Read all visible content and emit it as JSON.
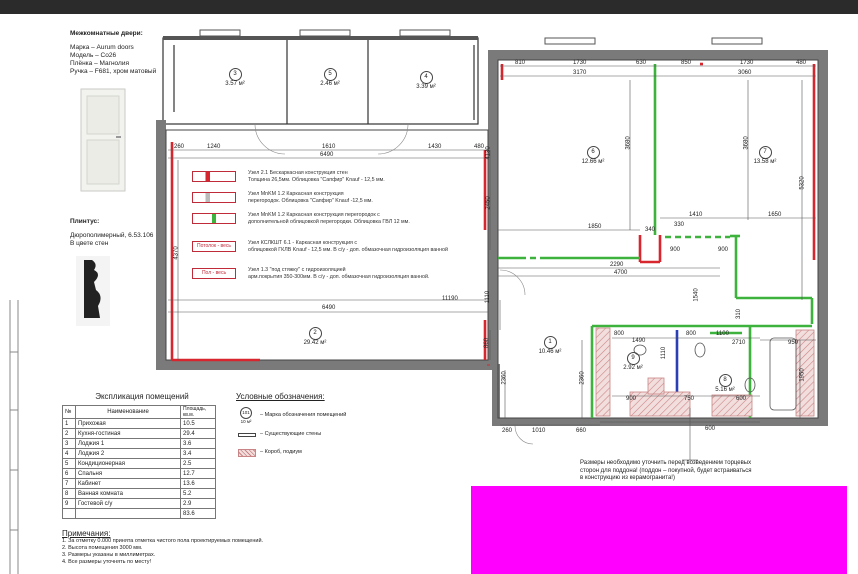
{
  "doors": {
    "title": "Межкомнатные двери:",
    "lines": [
      "Марка – Aurum doors",
      "Модель – Co26",
      "Плёнка – Магнолия",
      "Ручка – F681, хром матовый"
    ]
  },
  "plinth": {
    "title": "Плинтус:",
    "lines": [
      "Дюрополимерный, 6.53.106",
      "В цвете стен"
    ]
  },
  "rooms": [
    {
      "num": "3",
      "area": "3.57 м²"
    },
    {
      "num": "5",
      "area": "2.46 м²"
    },
    {
      "num": "4",
      "area": "3.39 м²"
    },
    {
      "num": "6",
      "area": "12.66 м²"
    },
    {
      "num": "7",
      "area": "13.58 м²"
    },
    {
      "num": "2",
      "area": "29.42 м²"
    },
    {
      "num": "1",
      "area": "10.46 м²"
    },
    {
      "num": "9",
      "area": "2.92 м²"
    },
    {
      "num": "8",
      "area": "5.16 м²"
    }
  ],
  "dims": {
    "top": [
      "810",
      "1730",
      "630",
      "850",
      "1730",
      "480"
    ],
    "top2": [
      "3170",
      "3060"
    ],
    "left_top": [
      "260",
      "1240",
      "1610",
      "1430",
      "400",
      "480"
    ],
    "left_total": "6490",
    "mid": [
      "1850",
      "2290",
      "4700",
      "1410",
      "1650",
      "900",
      "340",
      "330",
      "900"
    ],
    "long": "11190",
    "bottom_row": "6490",
    "vertical": [
      "4130",
      "2450",
      "1880",
      "3680",
      "5320",
      "4370",
      "1110",
      "860",
      "2360",
      "2360"
    ],
    "lower": [
      "800",
      "1490",
      "800",
      "1100",
      "2710",
      "950",
      "900",
      "1110",
      "1540",
      "600",
      "310",
      "660",
      "1010",
      "260",
      "750",
      "600",
      "1950"
    ]
  },
  "legend": [
    {
      "text": "Узел 2.1 Бескаркасная конструкция стен\nТолщина 26,5мм. Облицовка \"Сапфир\" Knauf - 12,5 мм.",
      "swatch": ""
    },
    {
      "text": "Узел MnKM 1.2 Каркасная конструкция\nперегородок. Облицовка \"Сапфир\" Knauf -12,5 мм.",
      "swatch": ""
    },
    {
      "text": "Узел MnKM 1.2 Каркасная конструкция перегородок с\nдополнительной облицовкой перегородки. Облицовка ГВЛ 12 мм.",
      "swatch": ""
    },
    {
      "text": "Узел КСЛКШТ 6.1 - Каркасная конструкция с\nоблицовкой ГКЛВ Knauf - 12,5 мм. В с/у - доп. обмазочная гидроизоляция ванной",
      "swatch": "Потолок - весь"
    },
    {
      "text": "Узел 1.3 \"под стяжку\" с гидроизоляцией\nарм.покрытия 350-300мм. В с/у - доп. обмазочная гидроизоляция ванной.",
      "swatch": "Пол - весь"
    }
  ],
  "explication": {
    "title": "Экспликация помещений",
    "headers": [
      "№",
      "Наименование",
      "Площадь, кв.м."
    ],
    "rows": [
      [
        "1",
        "Прихожая",
        "10.5"
      ],
      [
        "2",
        "Кухня-гостиная",
        "29.4"
      ],
      [
        "3",
        "Лоджия 1",
        "3.6"
      ],
      [
        "4",
        "Лоджия 2",
        "3.4"
      ],
      [
        "5",
        "Кондиционерная",
        "2.5"
      ],
      [
        "6",
        "Спальня",
        "12.7"
      ],
      [
        "7",
        "Кабинет",
        "13.6"
      ],
      [
        "8",
        "Ванная комната",
        "5.2"
      ],
      [
        "9",
        "Гостевой с/у",
        "2.9"
      ],
      [
        "",
        "",
        "83.6"
      ]
    ]
  },
  "symbols": {
    "title": "Условные обозначения:",
    "marker_num": "101",
    "marker_area": "10 м²",
    "marker_text": "– Марка обозначения помещений",
    "walls_text": "– Существующие стены",
    "box_text": "– Короб, подиум"
  },
  "notes": {
    "title": "Примечания:",
    "items": [
      "1.  За отметку 0.000 принята отметка чистого пола проектируемых помещений.",
      "2.  Высота помещения 3000 мм.",
      "3.  Размеры указаны в миллиметрах.",
      "4.  Все размеры уточнять по месту!"
    ]
  },
  "bath_note": "Размеры необходимо уточнить перед возведением торцевых\nсторон для поддона! (поддон – покупной, будет встраиваться\nв конструкцию из керамогранита!)",
  "colors": {
    "red": "#d8262f",
    "green": "#3db33d",
    "blue": "#2a3fb5",
    "hatch": "#c98585",
    "magenta": "#ff00ff"
  }
}
